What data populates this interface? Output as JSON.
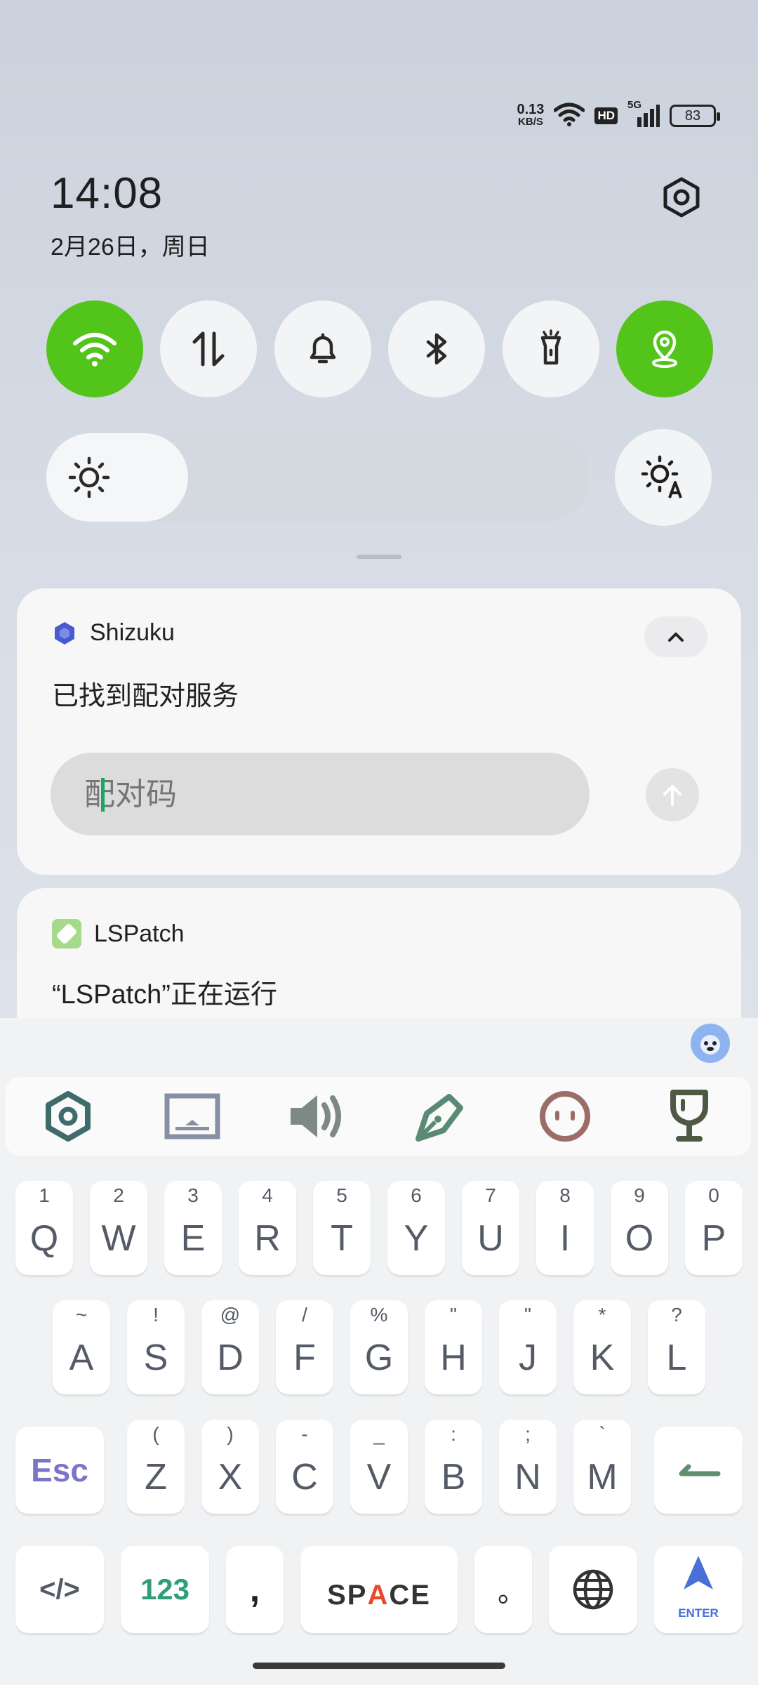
{
  "status_bar": {
    "net_speed": "0.13",
    "net_unit": "KB/S",
    "hd": "HD",
    "network": "5G",
    "battery": "83"
  },
  "header": {
    "time": "14:08",
    "date": "2月26日，周日"
  },
  "colors": {
    "tile_on": "#52c41a",
    "caret": "#1aa760",
    "esc": "#7b74c9",
    "num_key": "#2f9e7a",
    "space_a": "#e8492e",
    "enter": "#4a6fd6"
  },
  "notifications": [
    {
      "app": "Shizuku",
      "text": "已找到配对服务",
      "reply_placeholder": "配对码"
    },
    {
      "app": "LSPatch",
      "text": "“LSPatch”正在运行"
    }
  ],
  "keyboard": {
    "row1": [
      {
        "hint": "1",
        "key": "Q"
      },
      {
        "hint": "2",
        "key": "W"
      },
      {
        "hint": "3",
        "key": "E"
      },
      {
        "hint": "4",
        "key": "R"
      },
      {
        "hint": "5",
        "key": "T"
      },
      {
        "hint": "6",
        "key": "Y"
      },
      {
        "hint": "7",
        "key": "U"
      },
      {
        "hint": "8",
        "key": "I"
      },
      {
        "hint": "9",
        "key": "O"
      },
      {
        "hint": "0",
        "key": "P"
      }
    ],
    "row2": [
      {
        "hint": "~",
        "key": "A"
      },
      {
        "hint": "!",
        "key": "S"
      },
      {
        "hint": "@",
        "key": "D"
      },
      {
        "hint": "/",
        "key": "F"
      },
      {
        "hint": "%",
        "key": "G"
      },
      {
        "hint": "\"",
        "key": "H"
      },
      {
        "hint": "\"",
        "key": "J"
      },
      {
        "hint": "*",
        "key": "K"
      },
      {
        "hint": "?",
        "key": "L"
      }
    ],
    "row3": [
      {
        "hint": "(",
        "key": "Z"
      },
      {
        "hint": ")",
        "key": "X"
      },
      {
        "hint": "-",
        "key": "C"
      },
      {
        "hint": "_",
        "key": "V"
      },
      {
        "hint": ":",
        "key": "B"
      },
      {
        "hint": ";",
        "key": "N"
      },
      {
        "hint": "`",
        "key": "M"
      }
    ],
    "esc": "Esc",
    "code": "</>",
    "numbers": "123",
    "comma": ",",
    "space_s": "S",
    "space_p": "P",
    "space_a": "A",
    "space_ce": "CE",
    "period": "。",
    "enter": "ENTER"
  }
}
